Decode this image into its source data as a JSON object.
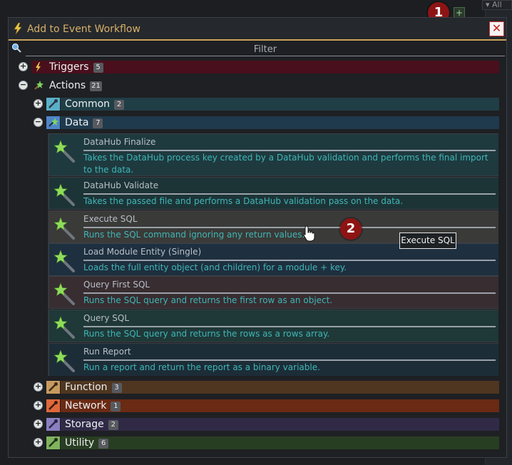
{
  "background": {
    "field_text": "All",
    "plus_glyph": "+"
  },
  "markers": [
    "1",
    "2"
  ],
  "dialog": {
    "title": "Add to Event Workflow",
    "close_glyph": "✕",
    "filter_placeholder": "Filter",
    "filter_value": ""
  },
  "tree": {
    "triggers": {
      "label": "Triggers",
      "count": "5",
      "toggle": "+",
      "color": "#4a0f1c"
    },
    "actions": {
      "label": "Actions",
      "count": "21",
      "toggle": "−"
    },
    "common": {
      "label": "Common",
      "count": "2",
      "toggle": "+",
      "color": "#1f3e46"
    },
    "data": {
      "label": "Data",
      "count": "7",
      "toggle": "−",
      "color": "#1f3a4d"
    },
    "function": {
      "label": "Function",
      "count": "3",
      "toggle": "+",
      "color": "#4f3620"
    },
    "network": {
      "label": "Network",
      "count": "1",
      "toggle": "+",
      "color": "#6a2a14"
    },
    "storage": {
      "label": "Storage",
      "count": "2",
      "toggle": "+",
      "color": "#302a47"
    },
    "utility": {
      "label": "Utility",
      "count": "6",
      "toggle": "+",
      "color": "#283e22"
    }
  },
  "data_items": [
    {
      "title": "DataHub Finalize",
      "description": "Takes the DataHub process key created by a DataHub validation and performs the final import to the data.",
      "bg": "#1e3a3f"
    },
    {
      "title": "DataHub Validate",
      "description": "Takes the passed file and performs a DataHub validation pass on the data.",
      "bg": "#1d3437"
    },
    {
      "title": "Execute SQL",
      "description": "Runs the SQL command ignoring any return values.",
      "bg": "#3a3a38"
    },
    {
      "title": "Load Module Entity (Single)",
      "description": "Loads the full entity object (and children) for a module + key.",
      "bg": "#1e2f3f"
    },
    {
      "title": "Query First SQL",
      "description": "Runs the SQL query and returns the first row as an object.",
      "bg": "#382d31"
    },
    {
      "title": "Query SQL",
      "description": "Runs the SQL query and returns the rows as a rows array.",
      "bg": "#1f3838"
    },
    {
      "title": "Run Report",
      "description": "Run a report and return the report as a binary variable.",
      "bg": "#1c2d38"
    }
  ],
  "tooltip": "Execute SQL",
  "colors": {
    "accent": "#c8a15a",
    "description_text": "#3fb6b6",
    "marker": "#8e1414"
  }
}
